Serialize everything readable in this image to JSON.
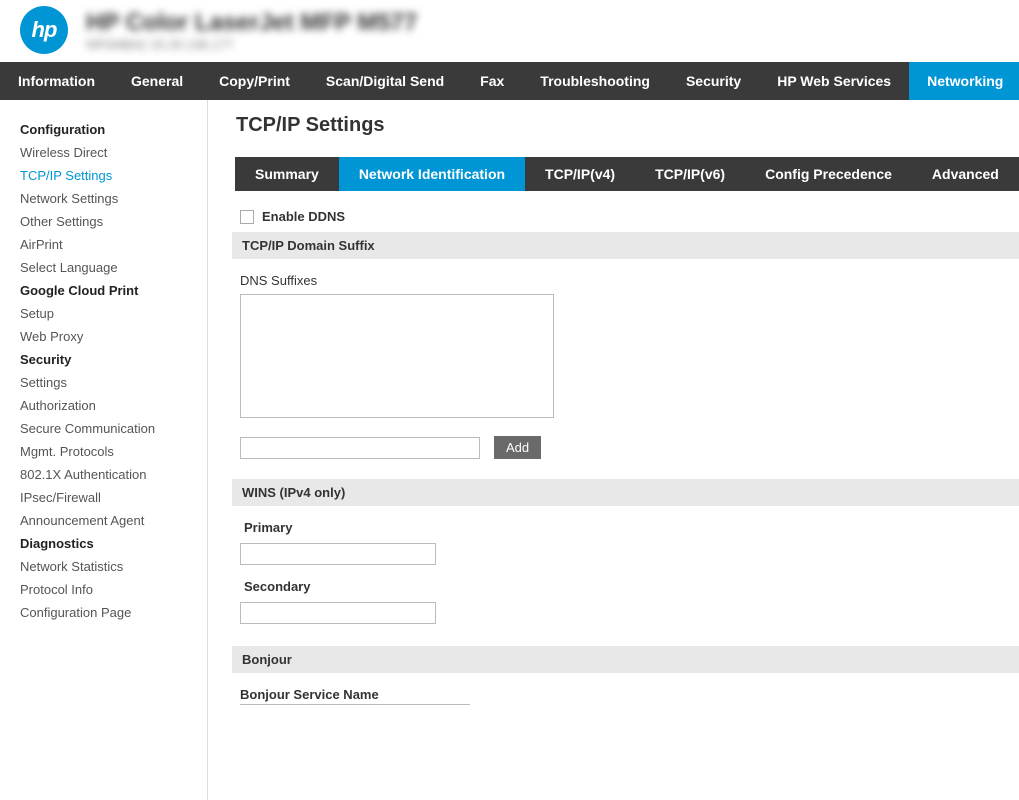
{
  "header": {
    "logo_text": "hp",
    "title": "HP Color LaserJet MFP M577",
    "subtitle": "NPI34BA2   15.25.136.177"
  },
  "main_nav": [
    {
      "label": "Information",
      "active": false
    },
    {
      "label": "General",
      "active": false
    },
    {
      "label": "Copy/Print",
      "active": false
    },
    {
      "label": "Scan/Digital Send",
      "active": false
    },
    {
      "label": "Fax",
      "active": false
    },
    {
      "label": "Troubleshooting",
      "active": false
    },
    {
      "label": "Security",
      "active": false
    },
    {
      "label": "HP Web Services",
      "active": false
    },
    {
      "label": "Networking",
      "active": true
    }
  ],
  "sidebar": [
    {
      "label": "Configuration",
      "heading": true,
      "active": false
    },
    {
      "label": "Wireless Direct",
      "heading": false,
      "active": false
    },
    {
      "label": "TCP/IP Settings",
      "heading": false,
      "active": true
    },
    {
      "label": "Network Settings",
      "heading": false,
      "active": false
    },
    {
      "label": "Other Settings",
      "heading": false,
      "active": false
    },
    {
      "label": "AirPrint",
      "heading": false,
      "active": false
    },
    {
      "label": "Select Language",
      "heading": false,
      "active": false
    },
    {
      "label": "Google Cloud Print",
      "heading": true,
      "active": false
    },
    {
      "label": "Setup",
      "heading": false,
      "active": false
    },
    {
      "label": "Web Proxy",
      "heading": false,
      "active": false
    },
    {
      "label": "Security",
      "heading": true,
      "active": false
    },
    {
      "label": "Settings",
      "heading": false,
      "active": false
    },
    {
      "label": "Authorization",
      "heading": false,
      "active": false
    },
    {
      "label": "Secure Communication",
      "heading": false,
      "active": false
    },
    {
      "label": "Mgmt. Protocols",
      "heading": false,
      "active": false
    },
    {
      "label": "802.1X Authentication",
      "heading": false,
      "active": false
    },
    {
      "label": "IPsec/Firewall",
      "heading": false,
      "active": false
    },
    {
      "label": "Announcement Agent",
      "heading": false,
      "active": false
    },
    {
      "label": "Diagnostics",
      "heading": true,
      "active": false
    },
    {
      "label": "Network Statistics",
      "heading": false,
      "active": false
    },
    {
      "label": "Protocol Info",
      "heading": false,
      "active": false
    },
    {
      "label": "Configuration Page",
      "heading": false,
      "active": false
    }
  ],
  "page": {
    "title": "TCP/IP Settings",
    "sub_tabs": [
      {
        "label": "Summary",
        "active": false
      },
      {
        "label": "Network Identification",
        "active": true
      },
      {
        "label": "TCP/IP(v4)",
        "active": false
      },
      {
        "label": "TCP/IP(v6)",
        "active": false
      },
      {
        "label": "Config Precedence",
        "active": false
      },
      {
        "label": "Advanced",
        "active": false
      }
    ],
    "ddns": {
      "label": "Enable DDNS",
      "checked": false
    },
    "domain_suffix": {
      "header": "TCP/IP Domain Suffix",
      "list_label": "DNS Suffixes",
      "add_button": "Add",
      "input_value": ""
    },
    "wins": {
      "header": "WINS (IPv4 only)",
      "primary_label": "Primary",
      "primary_value": "",
      "secondary_label": "Secondary",
      "secondary_value": ""
    },
    "bonjour": {
      "header": "Bonjour",
      "service_name_label": "Bonjour Service Name"
    }
  }
}
